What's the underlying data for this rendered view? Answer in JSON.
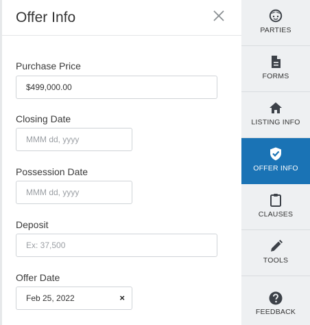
{
  "panel": {
    "title": "Offer Info",
    "close_icon": "close-icon"
  },
  "fields": {
    "purchase_price": {
      "label": "Purchase Price",
      "value": "$499,000.00"
    },
    "closing_date": {
      "label": "Closing Date",
      "placeholder": "MMM dd, yyyy"
    },
    "possession_date": {
      "label": "Possession Date",
      "placeholder": "MMM dd, yyyy"
    },
    "deposit": {
      "label": "Deposit",
      "placeholder": "Ex: 37,500"
    },
    "offer_date": {
      "label": "Offer Date",
      "value": "Feb 25, 2022",
      "clear": "×"
    }
  },
  "sidebar": {
    "accent": "#1a73b5",
    "items": [
      {
        "label": "PARTIES",
        "icon": "face-icon"
      },
      {
        "label": "FORMS",
        "icon": "document-icon"
      },
      {
        "label": "LISTING INFO",
        "icon": "home-icon"
      },
      {
        "label": "OFFER INFO",
        "icon": "shield-check-icon",
        "active": true
      },
      {
        "label": "CLAUSES",
        "icon": "clipboard-icon"
      },
      {
        "label": "TOOLS",
        "icon": "pencil-icon"
      },
      {
        "label": "FEEDBACK",
        "icon": "help-circle-icon"
      }
    ]
  }
}
